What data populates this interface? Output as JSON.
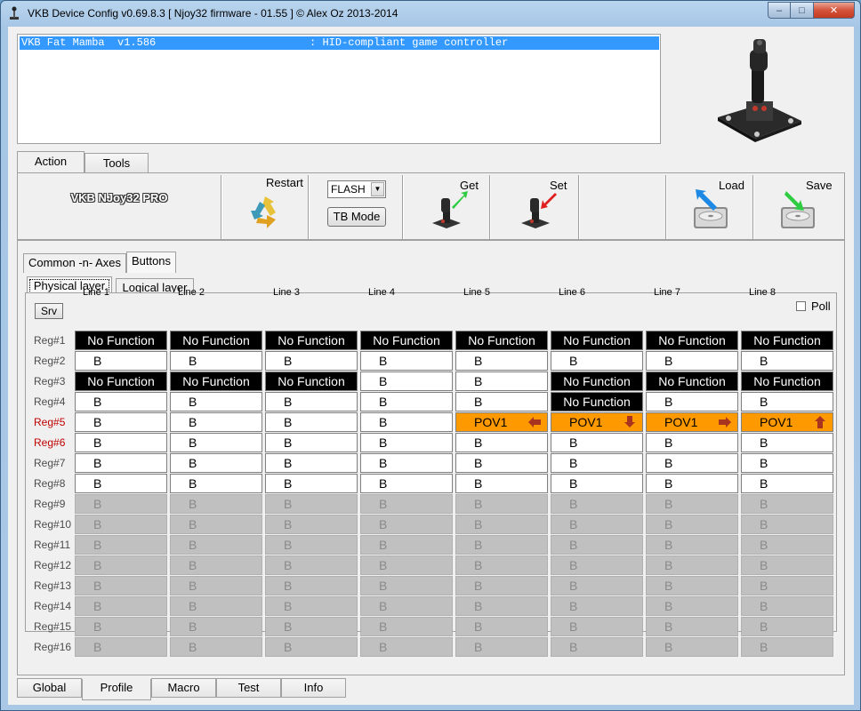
{
  "window": {
    "title": "VKB Device Config v0.69.8.3 [ Njoy32 firmware - 01.55 ] © Alex Oz 2013-2014"
  },
  "device_list": {
    "items": [
      {
        "text": "VKB Fat Mamba  v1.586                        : HID-compliant game controller"
      }
    ]
  },
  "top_tabs": [
    "Action",
    "Tools"
  ],
  "toolbar": {
    "device_name": "VKB NJoy32 PRO",
    "restart_label": "Restart",
    "flash_value": "FLASH",
    "tb_mode_label": "TB Mode",
    "get_label": "Get",
    "set_label": "Set",
    "load_label": "Load",
    "save_label": "Save"
  },
  "sub_tabs": [
    "Common -n- Axes",
    "Buttons"
  ],
  "layer_tabs": [
    "Physical layer",
    "Logical layer"
  ],
  "srv_label": "Srv",
  "poll_label": "Poll",
  "columns": [
    "Line 1",
    "Line 2",
    "Line 3",
    "Line 4",
    "Line 5",
    "Line 6",
    "Line 7",
    "Line 8"
  ],
  "rows": [
    {
      "label": "Reg#1",
      "highlight": false,
      "cells": [
        "No Function",
        "No Function",
        "No Function",
        "No Function",
        "No Function",
        "No Function",
        "No Function",
        "No Function"
      ],
      "types": [
        "nf",
        "nf",
        "nf",
        "nf",
        "nf",
        "nf",
        "nf",
        "nf"
      ]
    },
    {
      "label": "Reg#2",
      "highlight": false,
      "cells": [
        "B",
        "B",
        "B",
        "B",
        "B",
        "B",
        "B",
        "B"
      ],
      "types": [
        "n",
        "n",
        "n",
        "n",
        "n",
        "n",
        "n",
        "n"
      ]
    },
    {
      "label": "Reg#3",
      "highlight": false,
      "cells": [
        "No Function",
        "No Function",
        "No Function",
        "B",
        "B",
        "No Function",
        "No Function",
        "No Function"
      ],
      "types": [
        "nf",
        "nf",
        "nf",
        "n",
        "n",
        "nf",
        "nf",
        "nf"
      ]
    },
    {
      "label": "Reg#4",
      "highlight": false,
      "cells": [
        "B",
        "B",
        "B",
        "B",
        "B",
        "No Function",
        "B",
        "B"
      ],
      "types": [
        "n",
        "n",
        "n",
        "n",
        "n",
        "nf",
        "n",
        "n"
      ]
    },
    {
      "label": "Reg#5",
      "highlight": true,
      "cells": [
        "B",
        "B",
        "B",
        "B",
        "POV1",
        "POV1",
        "POV1",
        "POV1"
      ],
      "types": [
        "n",
        "n",
        "n",
        "n",
        "pov-left",
        "pov-down",
        "pov-right",
        "pov-up"
      ]
    },
    {
      "label": "Reg#6",
      "highlight": true,
      "cells": [
        "B",
        "B",
        "B",
        "B",
        "B",
        "B",
        "B",
        "B"
      ],
      "types": [
        "n",
        "n",
        "n",
        "n",
        "n",
        "n",
        "n",
        "n"
      ]
    },
    {
      "label": "Reg#7",
      "highlight": false,
      "cells": [
        "B",
        "B",
        "B",
        "B",
        "B",
        "B",
        "B",
        "B"
      ],
      "types": [
        "n",
        "n",
        "n",
        "n",
        "n",
        "n",
        "n",
        "n"
      ]
    },
    {
      "label": "Reg#8",
      "highlight": false,
      "cells": [
        "B",
        "B",
        "B",
        "B",
        "B",
        "B",
        "B",
        "B"
      ],
      "types": [
        "n",
        "n",
        "n",
        "n",
        "n",
        "n",
        "n",
        "n"
      ]
    },
    {
      "label": "Reg#9",
      "highlight": false,
      "cells": [
        "B",
        "B",
        "B",
        "B",
        "B",
        "B",
        "B",
        "B"
      ],
      "types": [
        "d",
        "d",
        "d",
        "d",
        "d",
        "d",
        "d",
        "d"
      ]
    },
    {
      "label": "Reg#10",
      "highlight": false,
      "cells": [
        "B",
        "B",
        "B",
        "B",
        "B",
        "B",
        "B",
        "B"
      ],
      "types": [
        "d",
        "d",
        "d",
        "d",
        "d",
        "d",
        "d",
        "d"
      ]
    },
    {
      "label": "Reg#11",
      "highlight": false,
      "cells": [
        "B",
        "B",
        "B",
        "B",
        "B",
        "B",
        "B",
        "B"
      ],
      "types": [
        "d",
        "d",
        "d",
        "d",
        "d",
        "d",
        "d",
        "d"
      ]
    },
    {
      "label": "Reg#12",
      "highlight": false,
      "cells": [
        "B",
        "B",
        "B",
        "B",
        "B",
        "B",
        "B",
        "B"
      ],
      "types": [
        "d",
        "d",
        "d",
        "d",
        "d",
        "d",
        "d",
        "d"
      ]
    },
    {
      "label": "Reg#13",
      "highlight": false,
      "cells": [
        "B",
        "B",
        "B",
        "B",
        "B",
        "B",
        "B",
        "B"
      ],
      "types": [
        "d",
        "d",
        "d",
        "d",
        "d",
        "d",
        "d",
        "d"
      ]
    },
    {
      "label": "Reg#14",
      "highlight": false,
      "cells": [
        "B",
        "B",
        "B",
        "B",
        "B",
        "B",
        "B",
        "B"
      ],
      "types": [
        "d",
        "d",
        "d",
        "d",
        "d",
        "d",
        "d",
        "d"
      ]
    },
    {
      "label": "Reg#15",
      "highlight": false,
      "cells": [
        "B",
        "B",
        "B",
        "B",
        "B",
        "B",
        "B",
        "B"
      ],
      "types": [
        "d",
        "d",
        "d",
        "d",
        "d",
        "d",
        "d",
        "d"
      ]
    },
    {
      "label": "Reg#16",
      "highlight": false,
      "cells": [
        "B",
        "B",
        "B",
        "B",
        "B",
        "B",
        "B",
        "B"
      ],
      "types": [
        "d",
        "d",
        "d",
        "d",
        "d",
        "d",
        "d",
        "d"
      ]
    }
  ],
  "bottom_tabs": [
    "Global",
    "Profile",
    "Macro",
    "Test",
    "Info"
  ],
  "active_bottom_tab": "Profile",
  "colors": {
    "selection": "#3399ff",
    "no_function_bg": "#000000",
    "pov_bg": "#ff9900",
    "pov_arrow": "#c0392b",
    "disabled_bg": "#c0c0c0",
    "highlight_label": "#c00000"
  },
  "icons": {
    "app": "joystick-icon",
    "restart": "recycle-icon",
    "get": "joystick-get-icon",
    "set": "joystick-set-icon",
    "load": "hard-drive-load-icon",
    "save": "hard-drive-save-icon"
  }
}
